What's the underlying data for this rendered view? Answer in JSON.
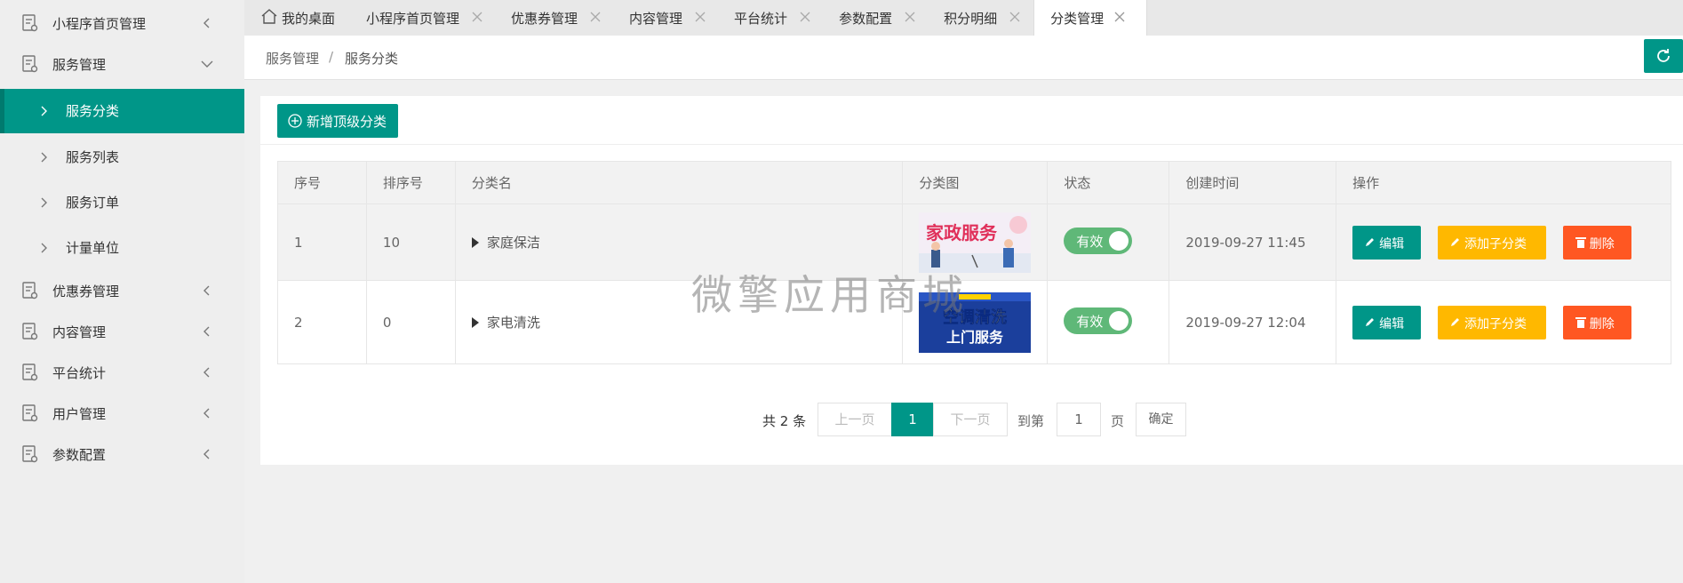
{
  "sidebar": {
    "groups": [
      {
        "label": "小程序首页管理"
      },
      {
        "label": "服务管理"
      },
      {
        "label": "优惠券管理"
      },
      {
        "label": "内容管理"
      },
      {
        "label": "平台统计"
      },
      {
        "label": "用户管理"
      },
      {
        "label": "参数配置"
      }
    ],
    "sub_items": [
      {
        "label": "服务分类",
        "active": true
      },
      {
        "label": "服务列表"
      },
      {
        "label": "服务订单"
      },
      {
        "label": "计量单位"
      }
    ]
  },
  "tabs": [
    {
      "label": "我的桌面"
    },
    {
      "label": "小程序首页管理"
    },
    {
      "label": "优惠券管理"
    },
    {
      "label": "内容管理"
    },
    {
      "label": "平台统计"
    },
    {
      "label": "参数配置"
    },
    {
      "label": "积分明细"
    },
    {
      "label": "分类管理",
      "active": true
    }
  ],
  "breadcrumb": {
    "parent": "服务管理",
    "separator": "/",
    "current": "服务分类"
  },
  "toolbar": {
    "add_label": "新增顶级分类"
  },
  "table": {
    "columns": [
      "序号",
      "排序号",
      "分类名",
      "分类图",
      "状态",
      "创建时间",
      "操作"
    ],
    "rows": [
      {
        "index": "1",
        "sort": "10",
        "name": "家庭保洁",
        "image_text": "家政服务",
        "status": "有效",
        "created": "2019-09-27 11:45"
      },
      {
        "index": "2",
        "sort": "0",
        "name": "家电清洗",
        "image_text": "空调清洗",
        "image_text2": "上门服务",
        "status": "有效",
        "created": "2019-09-27 12:04"
      }
    ],
    "actions": {
      "edit": "编辑",
      "add_child": "添加子分类",
      "delete": "删除"
    }
  },
  "pagination": {
    "total": "共 2 条",
    "prev": "上一页",
    "current": "1",
    "next": "下一页",
    "goto": "到第",
    "page_value": "1",
    "page_unit": "页",
    "confirm": "确定"
  },
  "watermark": "微擎应用商城",
  "colors": {
    "primary": "#009688",
    "switch_on": "#5fb878",
    "warn": "#ffb800",
    "danger": "#ff5722"
  }
}
